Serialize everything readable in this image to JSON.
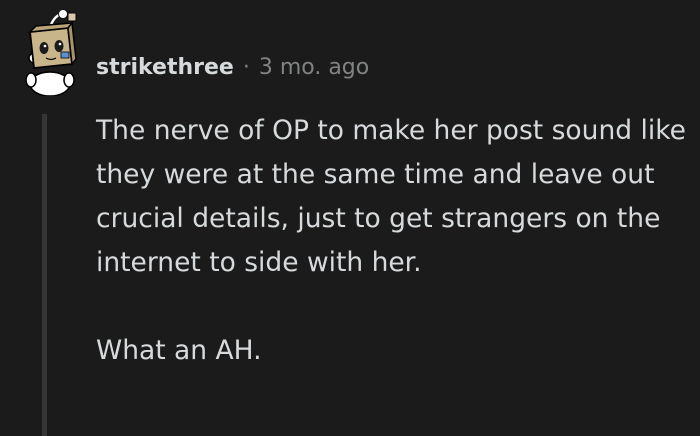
{
  "comment": {
    "username": "strikethree",
    "separator": "·",
    "timestamp": "3 mo. ago",
    "paragraphs": [
      "The nerve of OP to make her post sound like they were at the same time and leave out crucial details, just to get strangers on the internet to side with her.",
      "What an AH."
    ]
  },
  "avatar": {
    "icon": "snoo-box-head-avatar-icon"
  },
  "colors": {
    "background": "#1b1b1b",
    "text": "#d7dadc",
    "meta": "#818384",
    "thread_line": "#343536"
  }
}
